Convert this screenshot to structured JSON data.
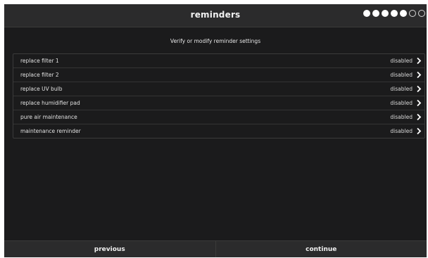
{
  "header": {
    "title": "reminders",
    "progress": {
      "completed": 5,
      "total": 7
    }
  },
  "subtitle": "Verify or modify reminder settings",
  "reminders": [
    {
      "label": "replace filter 1",
      "status": "disabled"
    },
    {
      "label": "replace filter 2",
      "status": "disabled"
    },
    {
      "label": "replace UV bulb",
      "status": "disabled"
    },
    {
      "label": "replace humidifier pad",
      "status": "disabled"
    },
    {
      "label": "pure air maintenance",
      "status": "disabled"
    },
    {
      "label": "maintenance reminder",
      "status": "disabled"
    }
  ],
  "footer": {
    "previous_label": "previous",
    "continue_label": "continue"
  },
  "icons": {
    "row_action": "chevron-right-icon",
    "progress_done": "filled-circle-icon",
    "progress_todo": "empty-circle-icon"
  },
  "colors": {
    "background": "#1b1b1c",
    "bar": "#2b2b2c",
    "text": "#f2f2f2"
  }
}
